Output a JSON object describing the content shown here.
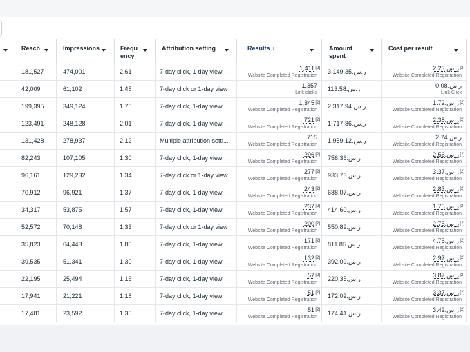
{
  "columns": {
    "reach": "Reach",
    "impressions": "Impressions",
    "frequency": "Frequ\nency",
    "attribution": "Attribution setting",
    "results": "Results ↓",
    "amount": "Amount\nspent",
    "cpr": "Cost per result"
  },
  "rows": [
    {
      "reach": "181,527",
      "impressions": "474,001",
      "frequency": "2.61",
      "attribution": "7-day click, 1-day view or...",
      "results": "1,411",
      "results_sup": "[2]",
      "results_type": "Website Completed Registration",
      "amount": "ر.س.3,149.35",
      "cpr": "ر.س.2.23",
      "cpr_sup": "[2]",
      "cpr_type": "Website Completed Registration"
    },
    {
      "reach": "42,009",
      "impressions": "61,102",
      "frequency": "1.45",
      "attribution": "7-day click or 1-day view",
      "results": "1,357",
      "results_sup": "",
      "results_type": "Link clicks",
      "amount": "ر.س.113.58",
      "cpr": "ر.س.0.08",
      "cpr_sup": "",
      "cpr_type": "Link Click"
    },
    {
      "reach": "199,395",
      "impressions": "349,124",
      "frequency": "1.75",
      "attribution": "7-day click, 1-day view or...",
      "results": "1,345",
      "results_sup": "[2]",
      "results_type": "Website Completed Registration",
      "amount": "ر.س.2,317.94",
      "cpr": "ر.س.1.72",
      "cpr_sup": "[2]",
      "cpr_type": "Website Completed Registration"
    },
    {
      "reach": "123,491",
      "impressions": "248,128",
      "frequency": "2.01",
      "attribution": "7-day click, 1-day view or...",
      "results": "721",
      "results_sup": "[2]",
      "results_type": "Website Completed Registration",
      "amount": "ر.س.1,717.86",
      "cpr": "ر.س.2.38",
      "cpr_sup": "[2]",
      "cpr_type": "Website Completed Registration"
    },
    {
      "reach": "131,428",
      "impressions": "278,937",
      "frequency": "2.12",
      "attribution": "Multiple attribution setti...",
      "results": "715",
      "results_sup": "",
      "results_type": "Website Completed Registration",
      "amount": "ر.س.1,959.12",
      "cpr": "ر.س.2.74",
      "cpr_sup": "",
      "cpr_type": "Website Completed Registration"
    },
    {
      "reach": "82,243",
      "impressions": "107,105",
      "frequency": "1.30",
      "attribution": "7-day click, 1-day view or...",
      "results": "296",
      "results_sup": "[2]",
      "results_type": "Website Completed Registration",
      "amount": "ر.س.756.36",
      "cpr": "ر.س.2.56",
      "cpr_sup": "[2]",
      "cpr_type": "Website Completed Registration"
    },
    {
      "reach": "96,161",
      "impressions": "129,232",
      "frequency": "1.34",
      "attribution": "7-day click or 1-day view",
      "results": "277",
      "results_sup": "[2]",
      "results_type": "Website Completed Registration",
      "amount": "ر.س.933.73",
      "cpr": "ر.س.3.37",
      "cpr_sup": "[2]",
      "cpr_type": "Website Completed Registration"
    },
    {
      "reach": "70,912",
      "impressions": "96,921",
      "frequency": "1.37",
      "attribution": "7-day click, 1-day view or...",
      "results": "243",
      "results_sup": "[2]",
      "results_type": "Website Completed Registration",
      "amount": "ر.س.688.07",
      "cpr": "ر.س.2.83",
      "cpr_sup": "[2]",
      "cpr_type": "Website Completed Registration"
    },
    {
      "reach": "34,317",
      "impressions": "53,875",
      "frequency": "1.57",
      "attribution": "7-day click, 1-day view or...",
      "results": "237",
      "results_sup": "[2]",
      "results_type": "Website Completed Registration",
      "amount": "ر.س.414.60",
      "cpr": "ر.س.1.75",
      "cpr_sup": "[2]",
      "cpr_type": "Website Completed Registration"
    },
    {
      "reach": "52,572",
      "impressions": "70,148",
      "frequency": "1.33",
      "attribution": "7-day click or 1-day view",
      "results": "200",
      "results_sup": "[2]",
      "results_type": "Website Completed Registration",
      "amount": "ر.س.550.89",
      "cpr": "ر.س.2.75",
      "cpr_sup": "[2]",
      "cpr_type": "Website Completed Registration"
    },
    {
      "reach": "35,823",
      "impressions": "64,443",
      "frequency": "1.80",
      "attribution": "7-day click, 1-day view or...",
      "results": "171",
      "results_sup": "[2]",
      "results_type": "Website Completed Registration",
      "amount": "ر.س.811.85",
      "cpr": "ر.س.4.75",
      "cpr_sup": "[2]",
      "cpr_type": "Website Completed Registration"
    },
    {
      "reach": "39,535",
      "impressions": "51,341",
      "frequency": "1.30",
      "attribution": "7-day click, 1-day view or...",
      "results": "132",
      "results_sup": "[2]",
      "results_type": "Website Completed Registration",
      "amount": "ر.س.392.09",
      "cpr": "ر.س.2.97",
      "cpr_sup": "[2]",
      "cpr_type": "Website Completed Registration"
    },
    {
      "reach": "22,195",
      "impressions": "25,494",
      "frequency": "1.15",
      "attribution": "7-day click, 1-day view or...",
      "results": "57",
      "results_sup": "[2]",
      "results_type": "Website Completed Registration",
      "amount": "ر.س.220.35",
      "cpr": "ر.س.3.87",
      "cpr_sup": "[2]",
      "cpr_type": "Website Completed Registration"
    },
    {
      "reach": "17,941",
      "impressions": "21,221",
      "frequency": "1.18",
      "attribution": "7-day click, 1-day view or...",
      "results": "51",
      "results_sup": "[2]",
      "results_type": "Website Completed Registration",
      "amount": "ر.س.172.02",
      "cpr": "ر.س.3.37",
      "cpr_sup": "[2]",
      "cpr_type": "Website Completed Registration"
    },
    {
      "reach": "17,481",
      "impressions": "23,592",
      "frequency": "1.35",
      "attribution": "7-day click, 1-day view or...",
      "results": "51",
      "results_sup": "[2]",
      "results_type": "Website Completed Registration",
      "amount": "ر.س.174.41",
      "cpr": "ر.س.3.42",
      "cpr_sup": "[2]",
      "cpr_type": "Website Completed Registration"
    }
  ]
}
